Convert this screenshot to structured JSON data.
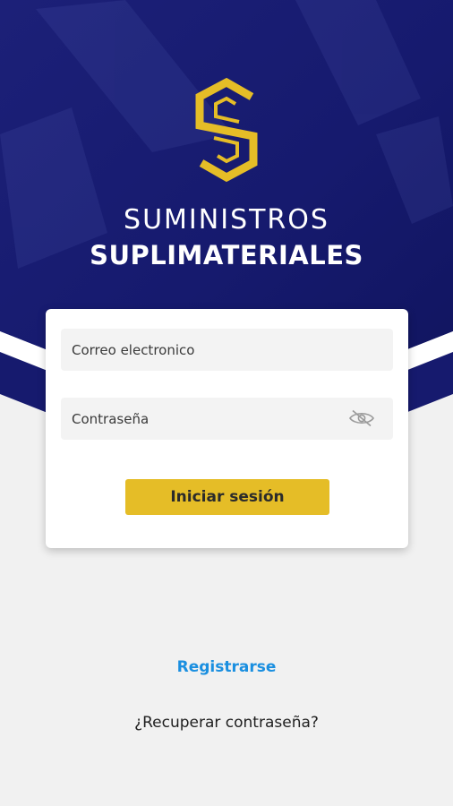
{
  "brand": {
    "line1": "SUMINISTROS",
    "line2": "SUPLIMATERIALES",
    "logo_icon": "double-s-logo-icon",
    "primary_color": "#161a6e",
    "accent_color": "#e5bd27"
  },
  "login_form": {
    "email_placeholder": "Correo electronico",
    "password_placeholder": "Contraseña",
    "password_toggle_icon": "eye-slash-icon",
    "submit_label": "Iniciar sesión"
  },
  "links": {
    "register": "Registrarse",
    "recover_password": "¿Recuperar contraseña?"
  }
}
